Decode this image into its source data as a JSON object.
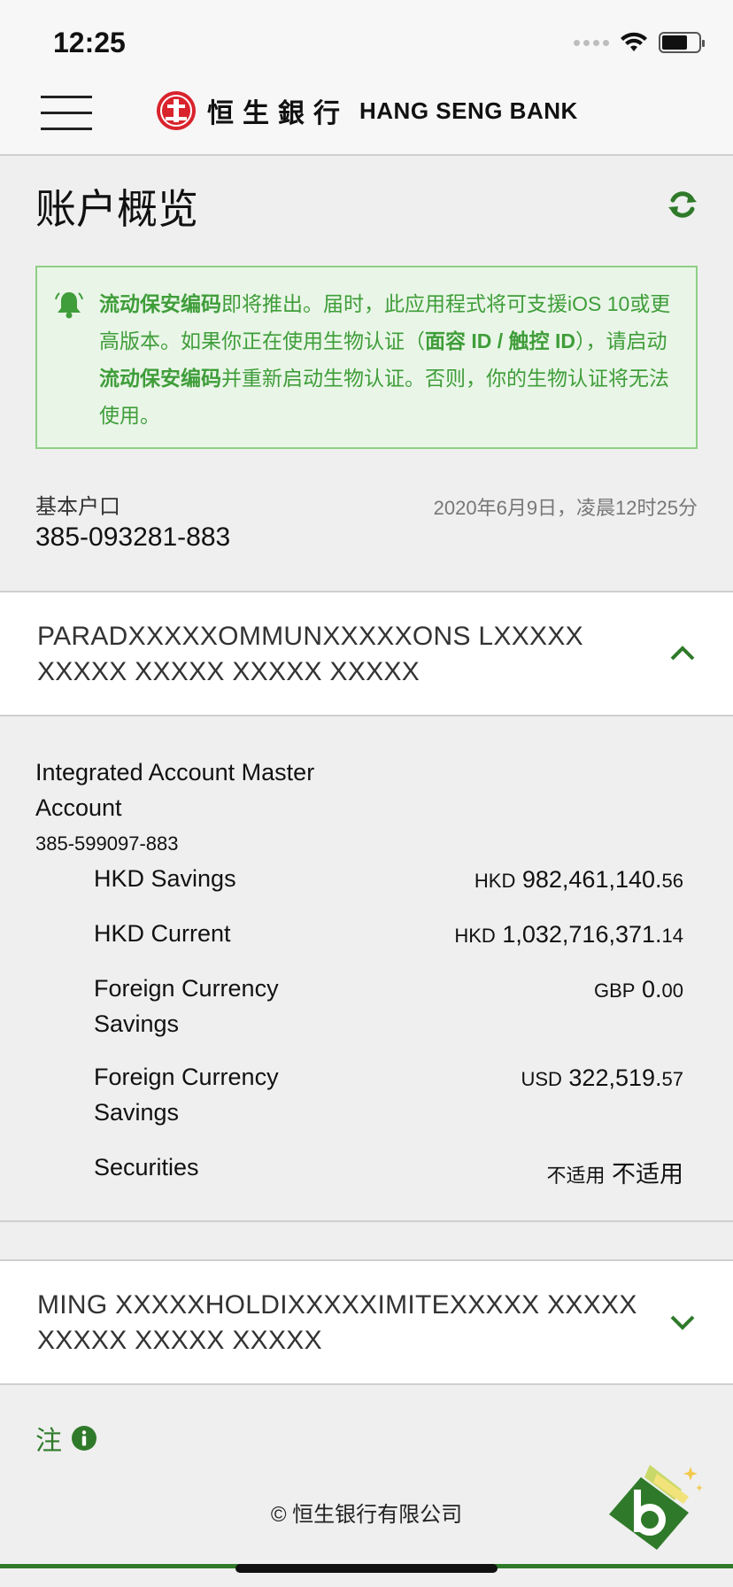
{
  "status_bar": {
    "time": "12:25",
    "battery_level": 0.7
  },
  "nav": {
    "logo_cn": "恒生銀行",
    "logo_en": "HANG SENG BANK",
    "logo_mark_color": "#d9232d"
  },
  "page": {
    "title": "账户概览"
  },
  "notice": {
    "p1_bold": "流动保安编码",
    "p1": "即将推出。届时，此应用程式将可支援iOS 10或更高版本。如果你正在使用生物认证（",
    "p1_bold2": "面容 ID / 触控 ID",
    "p2": "），请启动",
    "p2_bold": "流动保安编码",
    "p3": "并重新启动生物认证。否则，你的生物认证将无法使用。"
  },
  "primary_account": {
    "label": "基本户口",
    "number": "385-093281-883",
    "timestamp": "2020年6月9日，凌晨12时25分"
  },
  "groups": [
    {
      "name": "PARADXXXXXOMMUNXXXXXONS LXXXXX XXXXX XXXXX XXXXX XXXXX",
      "expanded": true
    },
    {
      "name": "MING XXXXXHOLDIXXXXXIMITEXXXXX XXXXX XXXXX XXXXX XXXXX",
      "expanded": false
    }
  ],
  "expanded_group": {
    "account_type": "Integrated Account Master Account",
    "account_number": "385-599097-883",
    "rows": [
      {
        "label": "HKD Savings",
        "currency": "HKD",
        "amount": "982,461,140.",
        "cents": "56"
      },
      {
        "label": "HKD Current",
        "currency": "HKD",
        "amount": "1,032,716,371.",
        "cents": "14"
      },
      {
        "label": "Foreign Currency Savings",
        "currency": "GBP",
        "amount": "0.",
        "cents": "00"
      },
      {
        "label": "Foreign Currency Savings",
        "currency": "USD",
        "amount": "322,519.",
        "cents": "57"
      },
      {
        "label": "Securities",
        "currency": "不适用",
        "amount": "不适用",
        "cents": ""
      }
    ]
  },
  "footer": {
    "note_label": "注",
    "copyright": "© 恒生银行有限公司"
  },
  "colors": {
    "accent_green": "#2f7a2a",
    "notice_text": "#3f9d3a",
    "notice_bg": "#e9f6e7",
    "notice_border": "#8fcf86"
  }
}
